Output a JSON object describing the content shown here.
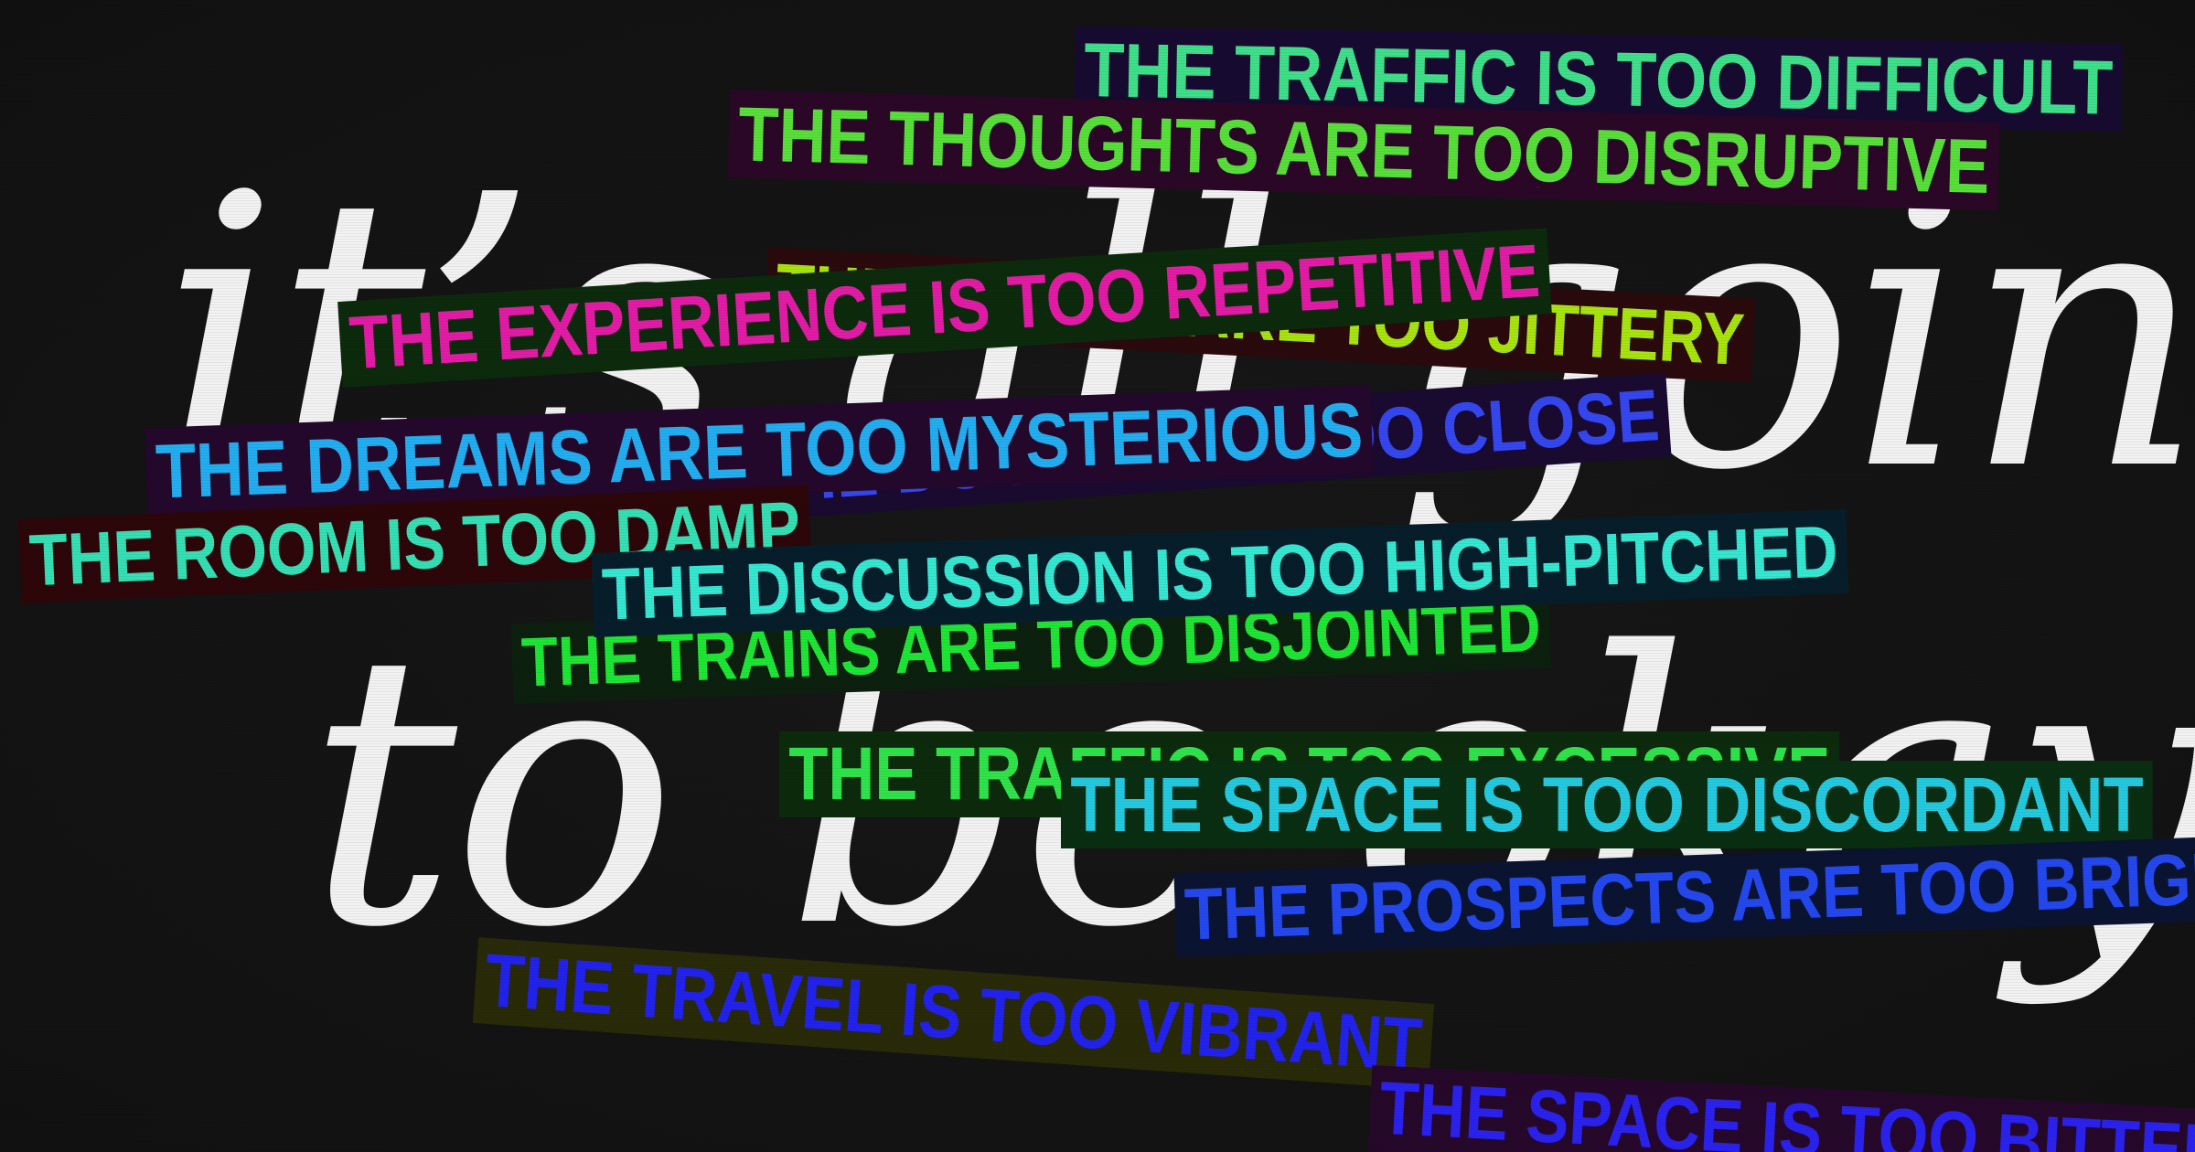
{
  "headline": {
    "line1": "it’s all going",
    "line2": "to be okay"
  },
  "phrases": [
    {
      "id": "events-jittery",
      "text": "THE EVENTS ARE TOO JITTERY",
      "color": "#a8e40f",
      "bg": "#2a0a0c"
    },
    {
      "id": "traffic-difficult",
      "text": "THE TRAFFIC IS TOO DIFFICULT",
      "color": "#3fe08a",
      "bg": "#170a30"
    },
    {
      "id": "thoughts-disruptive",
      "text": "THE THOUGHTS ARE TOO DISRUPTIVE",
      "color": "#58e03a",
      "bg": "#2a0726"
    },
    {
      "id": "experience-repetitive",
      "text": "THE EXPERIENCE IS TOO REPETITIVE",
      "color": "#e31ba6",
      "bg": "#0c2a0c"
    },
    {
      "id": "doors-close",
      "text": "THE DOORS ARE TOO CLOSE",
      "color": "#3547f0",
      "bg": "#1a0a30"
    },
    {
      "id": "dreams-mysterious",
      "text": "THE DREAMS ARE TOO MYSTERIOUS",
      "color": "#22aef0",
      "bg": "#24082c"
    },
    {
      "id": "room-damp",
      "text": "THE ROOM IS TOO DAMP",
      "color": "#35e0b4",
      "bg": "#2c0609"
    },
    {
      "id": "trains-disjointed",
      "text": "THE TRAINS ARE TOO DISJOINTED",
      "color": "#1ee634",
      "bg": "#0c200e"
    },
    {
      "id": "discussion-high-pitched",
      "text": "THE DISCUSSION IS TOO HIGH-PITCHED",
      "color": "#35e8d2",
      "bg": "#061e2a"
    },
    {
      "id": "traffic-excessive",
      "text": "THE TRAFFIC IS TOO EXCESSIVE",
      "color": "#2fe44a",
      "bg": "#0c2a0c"
    },
    {
      "id": "space-discordant",
      "text": "THE SPACE IS TOO DISCORDANT",
      "color": "#24cae0",
      "bg": "#0a2e12"
    },
    {
      "id": "prospects-bright",
      "text": "THE PROSPECTS ARE TOO BRIGHT",
      "color": "#2448f0",
      "bg": "#0a1430"
    },
    {
      "id": "travel-vibrant",
      "text": "THE TRAVEL IS TOO VIBRANT",
      "color": "#2222ee",
      "bg": "#282a08"
    },
    {
      "id": "space-bitter",
      "text": "THE SPACE IS TOO BITTER",
      "color": "#2a22ee",
      "bg": "#26082a"
    }
  ]
}
